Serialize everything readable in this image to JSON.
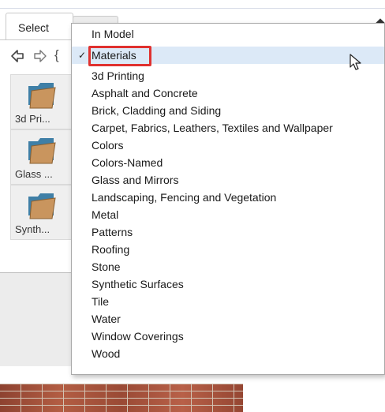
{
  "panel": {
    "tab_select_label": "Select",
    "nav_home_glyph": "{",
    "icons": [
      "back-arrow-icon",
      "forward-arrow-icon",
      "home-icon",
      "pencil-icon",
      "folder-icon"
    ],
    "tiles": [
      {
        "label": "3d Pri..."
      },
      {
        "label": "Glass ..."
      },
      {
        "label": "Synth..."
      }
    ]
  },
  "dropdown": {
    "selected_index": 1,
    "highlight_color": "#e0312f",
    "selection_bg": "#dce9f7",
    "check_mark": "✓",
    "items": [
      {
        "label": "In Model"
      },
      {
        "label": "Materials"
      },
      {
        "label": "3d Printing"
      },
      {
        "label": "Asphalt and Concrete"
      },
      {
        "label": "Brick, Cladding and Siding"
      },
      {
        "label": "Carpet, Fabrics, Leathers, Textiles and Wallpaper"
      },
      {
        "label": "Colors"
      },
      {
        "label": "Colors-Named"
      },
      {
        "label": "Glass and Mirrors"
      },
      {
        "label": "Landscaping, Fencing and Vegetation"
      },
      {
        "label": "Metal"
      },
      {
        "label": "Patterns"
      },
      {
        "label": "Roofing"
      },
      {
        "label": "Stone"
      },
      {
        "label": "Synthetic Surfaces"
      },
      {
        "label": "Tile"
      },
      {
        "label": "Water"
      },
      {
        "label": "Window Coverings"
      },
      {
        "label": "Wood"
      }
    ]
  }
}
